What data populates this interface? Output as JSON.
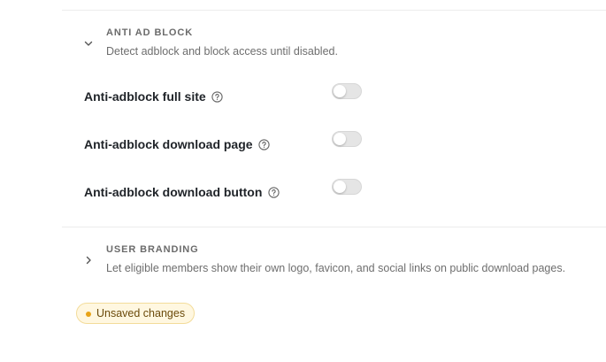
{
  "sections": {
    "anti_ad_block": {
      "title": "ANTI AD BLOCK",
      "description": "Detect adblock and block access until disabled.",
      "expanded": true,
      "chevron_icon": "chevron-down-icon",
      "settings": [
        {
          "label": "Anti-adblock full site",
          "help_icon": "help-circle-icon",
          "enabled": false
        },
        {
          "label": "Anti-adblock download page",
          "help_icon": "help-circle-icon",
          "enabled": false
        },
        {
          "label": "Anti-adblock download button",
          "help_icon": "help-circle-icon",
          "enabled": false
        }
      ]
    },
    "user_branding": {
      "title": "USER BRANDING",
      "description": "Let eligible members show their own logo, favicon, and social links on public download pages.",
      "expanded": false,
      "chevron_icon": "chevron-right-icon"
    }
  },
  "status_badge": {
    "text": "Unsaved changes",
    "dot_color": "#e8a317",
    "background": "#fff7e0"
  }
}
